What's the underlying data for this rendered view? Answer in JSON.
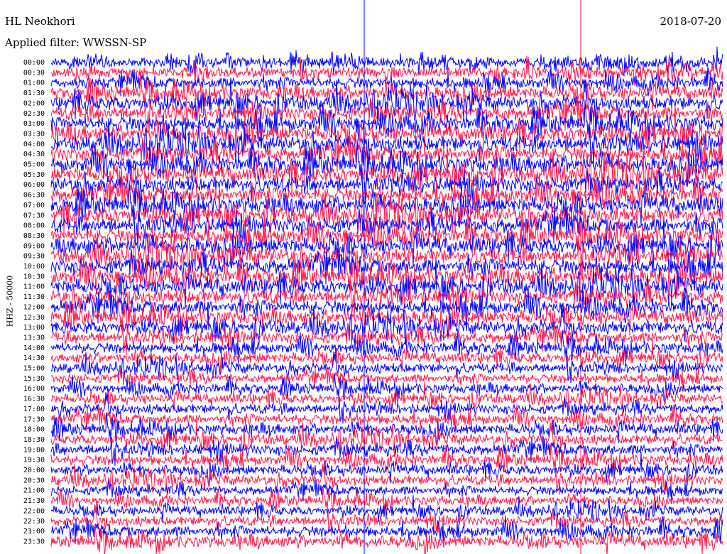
{
  "header": {
    "station": "HL Neokhori",
    "filter": "Applied filter: WWSSN-SP",
    "date": "2018-07-20"
  },
  "chart_data": {
    "type": "line",
    "title": "HL Neokhori",
    "subtitle": "Applied filter: WWSSN-SP",
    "date": "2018-07-20",
    "ylabel": "HHZ - 50000",
    "row_times": [
      "00:00",
      "00:30",
      "01:00",
      "01:30",
      "02:00",
      "02:30",
      "03:00",
      "03:30",
      "04:00",
      "04:30",
      "05:00",
      "05:30",
      "06:00",
      "06:30",
      "07:00",
      "07:30",
      "08:00",
      "08:30",
      "09:00",
      "09:30",
      "10:00",
      "10:30",
      "11:00",
      "11:30",
      "12:00",
      "12:30",
      "13:00",
      "13:30",
      "14:00",
      "14:30",
      "15:00",
      "15:30",
      "16:00",
      "16:30",
      "17:00",
      "17:30",
      "18:00",
      "18:30",
      "19:00",
      "19:30",
      "20:00",
      "20:30",
      "21:00",
      "21:30",
      "22:00",
      "22:30",
      "23:00",
      "23:30"
    ],
    "colors": [
      "#0000ff",
      "#ff1a4d"
    ],
    "relative_amplitude": [
      0.45,
      0.55,
      0.6,
      0.75,
      0.85,
      0.9,
      0.95,
      1.0,
      1.0,
      1.0,
      1.0,
      1.0,
      1.0,
      1.0,
      1.0,
      1.0,
      1.0,
      1.0,
      1.0,
      1.0,
      1.0,
      1.0,
      0.95,
      0.9,
      0.85,
      0.8,
      0.75,
      0.65,
      0.55,
      0.5,
      0.45,
      0.4,
      0.4,
      0.4,
      0.45,
      0.5,
      0.5,
      0.5,
      0.55,
      0.5,
      0.45,
      0.45,
      0.4,
      0.35,
      0.35,
      0.45,
      0.55,
      0.6
    ]
  }
}
